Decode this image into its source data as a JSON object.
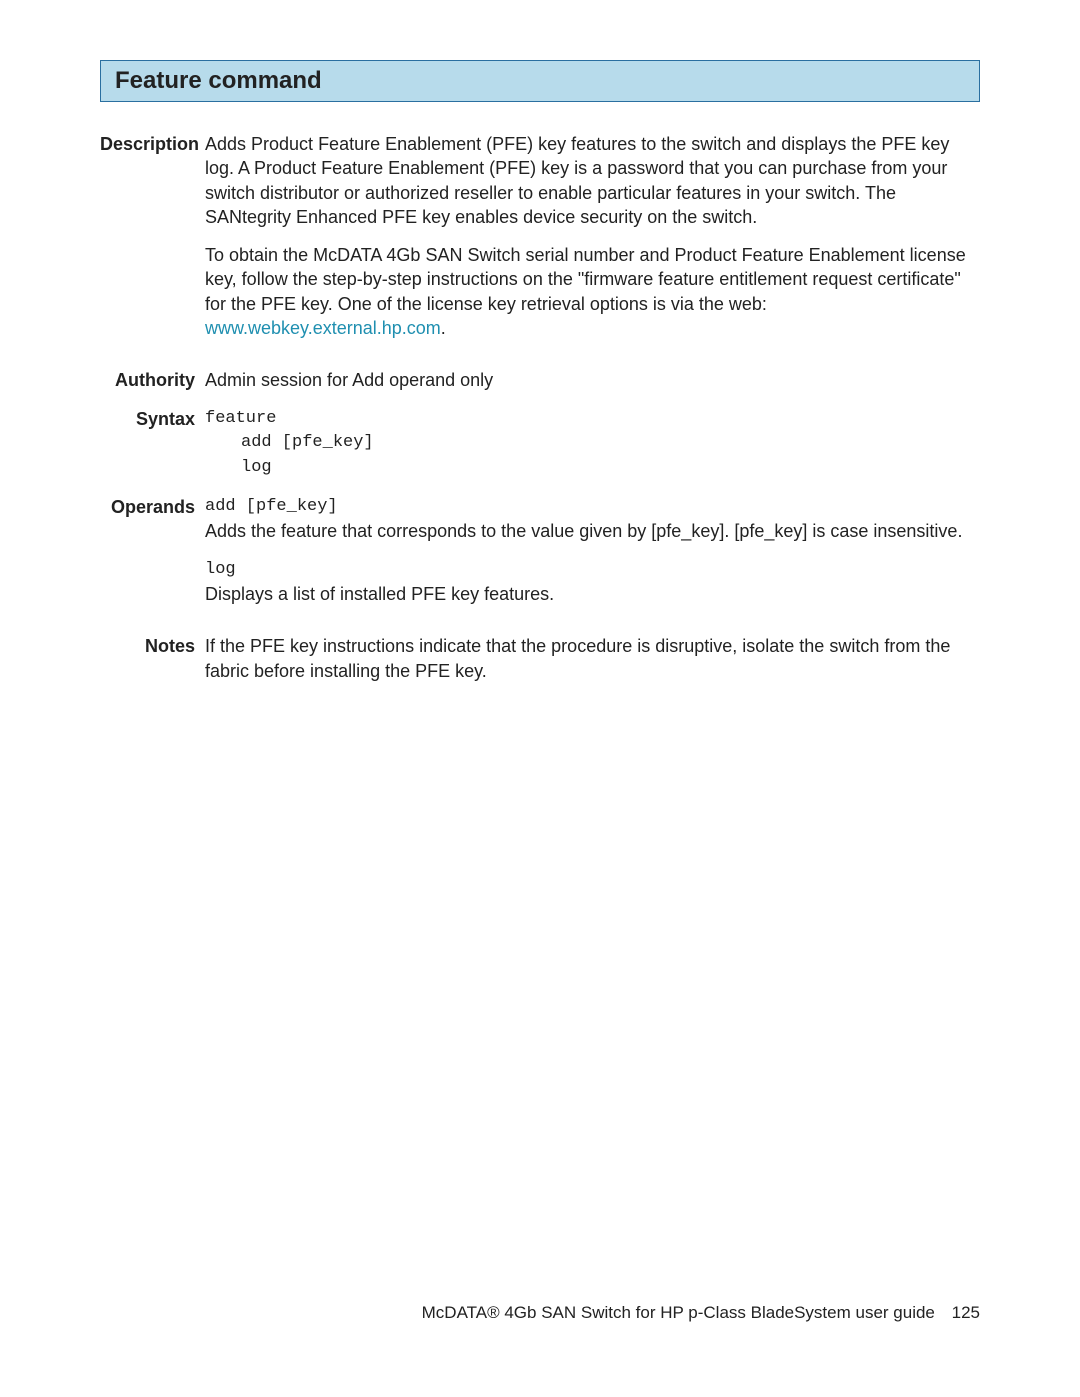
{
  "title": "Feature command",
  "labels": {
    "description": "Description",
    "authority": "Authority",
    "syntax": "Syntax",
    "operands": "Operands",
    "notes": "Notes"
  },
  "description": {
    "p1": "Adds Product Feature Enablement (PFE) key features to the switch and displays the PFE key log. A Product Feature Enablement (PFE) key is a password that you can purchase from your switch distributor or authorized reseller to enable particular features in your switch. The SANtegrity Enhanced PFE key enables device security on the switch.",
    "p2_pre": "To obtain the McDATA 4Gb SAN Switch serial number and Product Feature Enablement license key, follow the step-by-step instructions on the \"firmware feature entitlement request certificate\" for the PFE key. One of the license key retrieval options is via the web: ",
    "p2_link": "www.webkey.external.hp.com",
    "p2_post": "."
  },
  "authority": "Admin session for Add operand only",
  "syntax": {
    "line1": "feature",
    "line2": "add [pfe_key]",
    "line3": "log"
  },
  "operands": {
    "op1_code": "add [pfe_key]",
    "op1_text": "Adds the feature that corresponds to the value given by [pfe_key]. [pfe_key] is case insensitive.",
    "op2_code": "log",
    "op2_text": "Displays a list of installed PFE key features."
  },
  "notes": "If the PFE key instructions indicate that the procedure is disruptive, isolate the switch from the fabric before installing the PFE key.",
  "footer": {
    "text": "McDATA® 4Gb SAN Switch for HP p-Class BladeSystem user guide",
    "page": "125"
  }
}
